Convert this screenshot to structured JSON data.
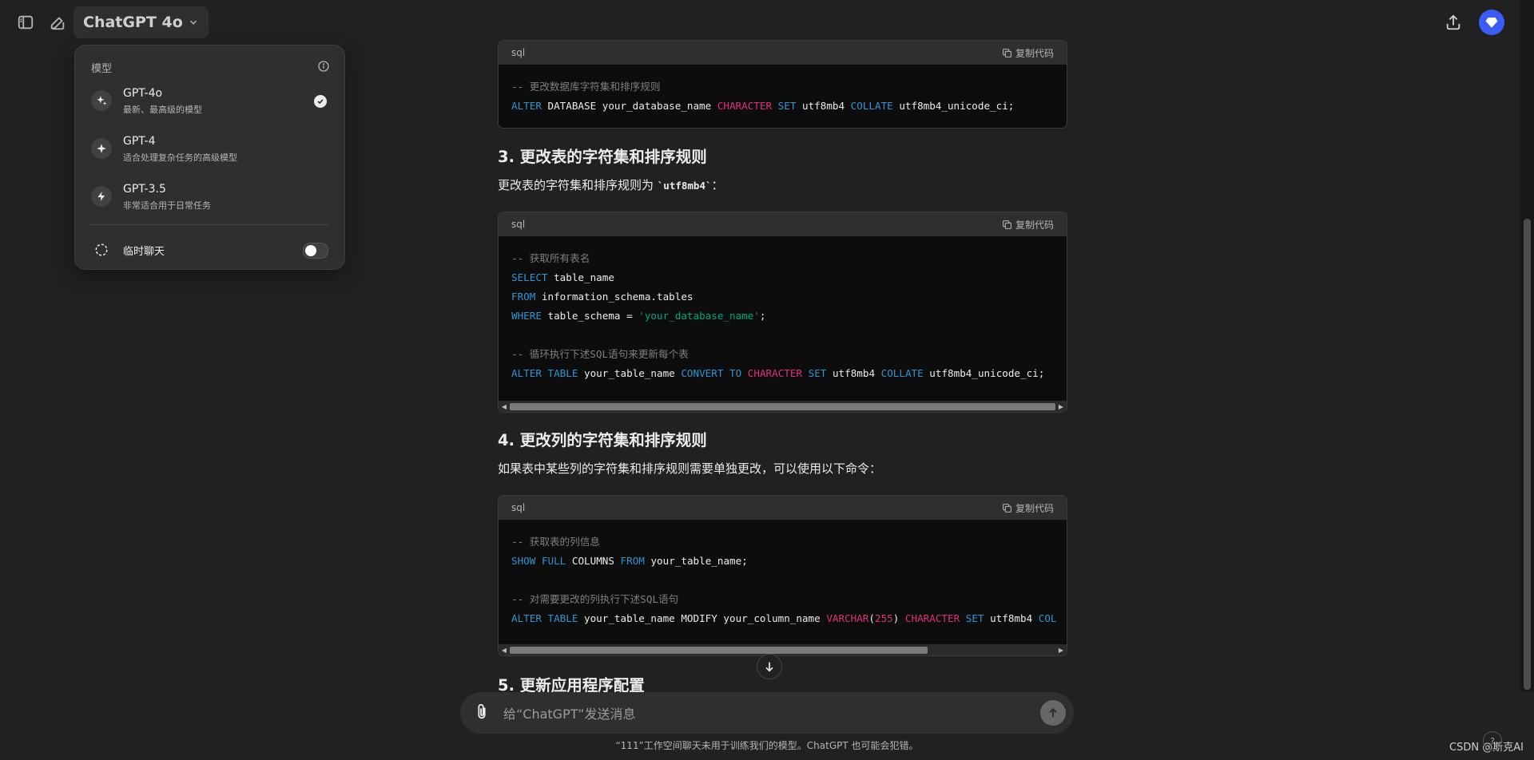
{
  "header": {
    "model_label": "ChatGPT 4o"
  },
  "model_menu": {
    "title": "模型",
    "items": [
      {
        "name": "GPT-4o",
        "desc": "最新、最高级的模型",
        "selected": true
      },
      {
        "name": "GPT-4",
        "desc": "适合处理复杂任务的高级模型",
        "selected": false
      },
      {
        "name": "GPT-3.5",
        "desc": "非常适合用于日常任务",
        "selected": false
      }
    ],
    "temp_chat_label": "临时聊天",
    "temp_chat_enabled": false
  },
  "code_blocks": [
    {
      "lang": "sql",
      "copy_label": "复制代码"
    },
    {
      "lang": "sql",
      "copy_label": "复制代码"
    },
    {
      "lang": "sql",
      "copy_label": "复制代码"
    }
  ],
  "code1": {
    "c1": "-- 更改数据库字符集和排序规则",
    "l2": [
      "ALTER",
      " DATABASE your_database_name ",
      "CHARACTER",
      " ",
      "SET",
      " utf8mb4 ",
      "COLLATE",
      " utf8mb4_unicode_ci;"
    ]
  },
  "section3": {
    "title": "3. 更改表的字符集和排序规则",
    "para_pre": "更改表的字符集和排序规则为 ",
    "para_code": "`utf8mb4`",
    "para_post": "："
  },
  "code2": {
    "c1": "-- 获取所有表名",
    "l2": [
      "SELECT",
      " table_name"
    ],
    "l3": [
      "FROM",
      " information_schema.tables"
    ],
    "l4": [
      "WHERE",
      " table_schema = ",
      "'your_database_name'",
      ";"
    ],
    "c5": "-- 循环执行下述SQL语句来更新每个表",
    "l6": [
      "ALTER",
      " ",
      "TABLE",
      " your_table_name ",
      "CONVERT",
      " ",
      "TO",
      " ",
      "CHARACTER",
      " ",
      "SET",
      " utf8mb4 ",
      "COLLATE",
      " utf8mb4_unicode_ci;"
    ]
  },
  "section4": {
    "title": "4. 更改列的字符集和排序规则",
    "para": "如果表中某些列的字符集和排序规则需要单独更改，可以使用以下命令："
  },
  "code3": {
    "c1": "-- 获取表的列信息",
    "l2": [
      "SHOW",
      " ",
      "FULL",
      " COLUMNS ",
      "FROM",
      " your_table_name;"
    ],
    "c4": "-- 对需要更改的列执行下述SQL语句",
    "l5": [
      "ALTER",
      " ",
      "TABLE",
      " your_table_name MODIFY your_column_name ",
      "VARCHAR",
      "(",
      "255",
      ") ",
      "CHARACTER",
      " ",
      "SET",
      " utf8mb4 ",
      "COL"
    ]
  },
  "section5": {
    "title": "5. 更新应用程序配置"
  },
  "composer": {
    "placeholder": "给“ChatGPT”发送消息"
  },
  "footer": {
    "text": "“111”工作空间聊天未用于训练我们的模型。ChatGPT 也可能会犯错。",
    "watermark": "CSDN @斯克AI",
    "help": "?"
  },
  "colors": {
    "background": "#212121",
    "code_bg": "#0d0d0d",
    "keyword_blue": "#2e95d3",
    "keyword_red": "#df3079",
    "string_green": "#00a67d",
    "avatar": "#3b5cf6"
  }
}
